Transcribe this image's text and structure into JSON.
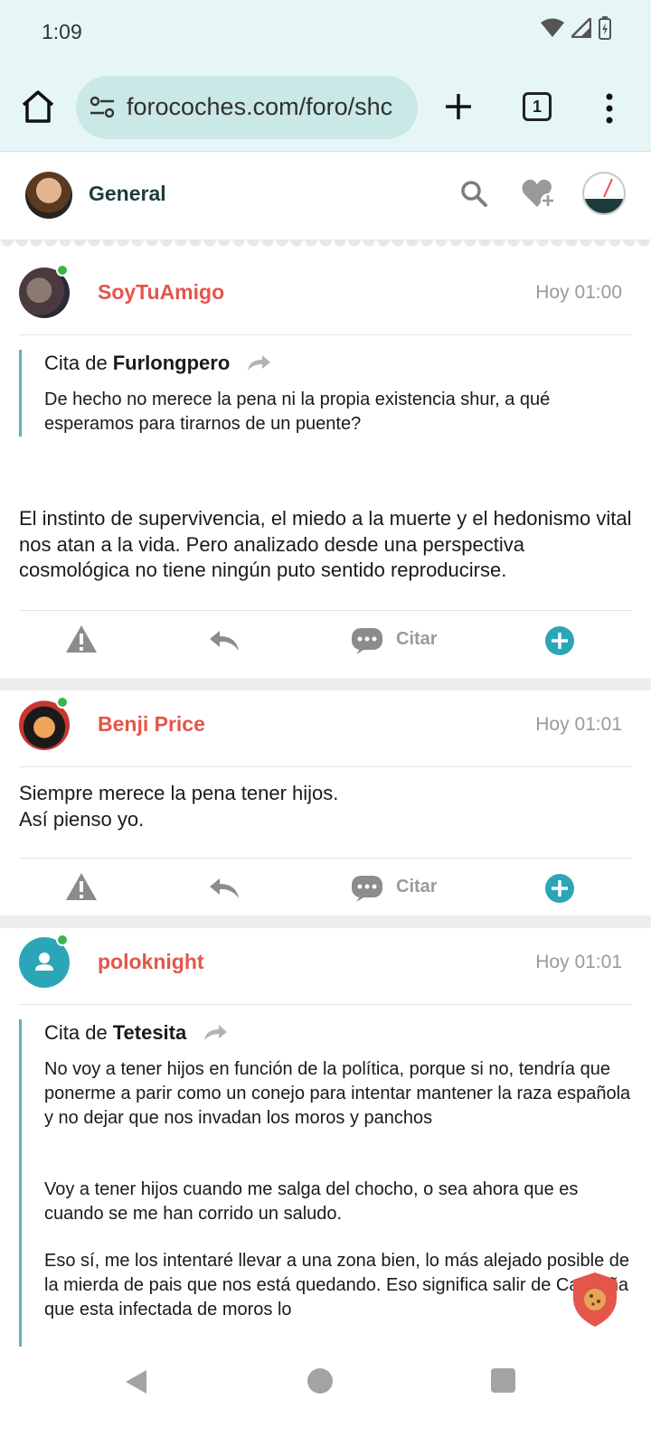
{
  "status": {
    "time": "1:09"
  },
  "browser": {
    "url": "forocoches.com/foro/shc",
    "tab_count": "1"
  },
  "header": {
    "forum_name": "General"
  },
  "posts": [
    {
      "username": "SoyTuAmigo",
      "time": "Hoy 01:00",
      "online": true,
      "quote": {
        "prefix": "Cita de",
        "author": "Furlongpero",
        "paragraphs": [
          "De hecho no merece la pena ni la propia existencia shur, a qué esperamos para tirarnos de un puente?"
        ]
      },
      "body": [
        "El instinto de supervivencia, el miedo a la muerte y el hedonismo vital nos atan a la vida. Pero analizado desde una perspectiva cosmológica no tiene ningún puto sentido reproducirse."
      ]
    },
    {
      "username": "Benji Price",
      "time": "Hoy 01:01",
      "online": true,
      "body": [
        "Siempre merece la pena tener hijos.",
        "Así pienso yo."
      ]
    },
    {
      "username": "poloknight",
      "time": "Hoy 01:01",
      "online": true,
      "quote": {
        "prefix": "Cita de",
        "author": "Tetesita",
        "paragraphs": [
          "No voy a tener hijos en función de la política, porque si no, tendría que ponerme a parir como un conejo para intentar mantener la raza española y no dejar que nos invadan los moros y panchos",
          "Voy a tener hijos cuando me salga del chocho, o sea ahora que es cuando se me han corrido un saludo.",
          "Eso sí, me los intentaré llevar a una zona bien, lo más alejado posible de la mierda de pais que nos está quedando. Eso significa salir de Cataluña que esta infectada de moros lo"
        ]
      }
    }
  ],
  "actions": {
    "cite_label": "Citar"
  },
  "icons": {
    "home": "home-icon",
    "tune": "site-settings-icon",
    "new_tab": "plus-icon",
    "menu": "more-vert-icon",
    "search": "search-icon",
    "favorite": "heart-plus-icon",
    "report": "warning-icon",
    "reply": "reply-icon",
    "quote": "quote-bubble-icon",
    "more": "plus-circle-icon",
    "cookie": "cookie-shield-icon"
  },
  "colors": {
    "accent": "#e4554a",
    "teal": "#2ba6b8",
    "online": "#3ab54a"
  }
}
